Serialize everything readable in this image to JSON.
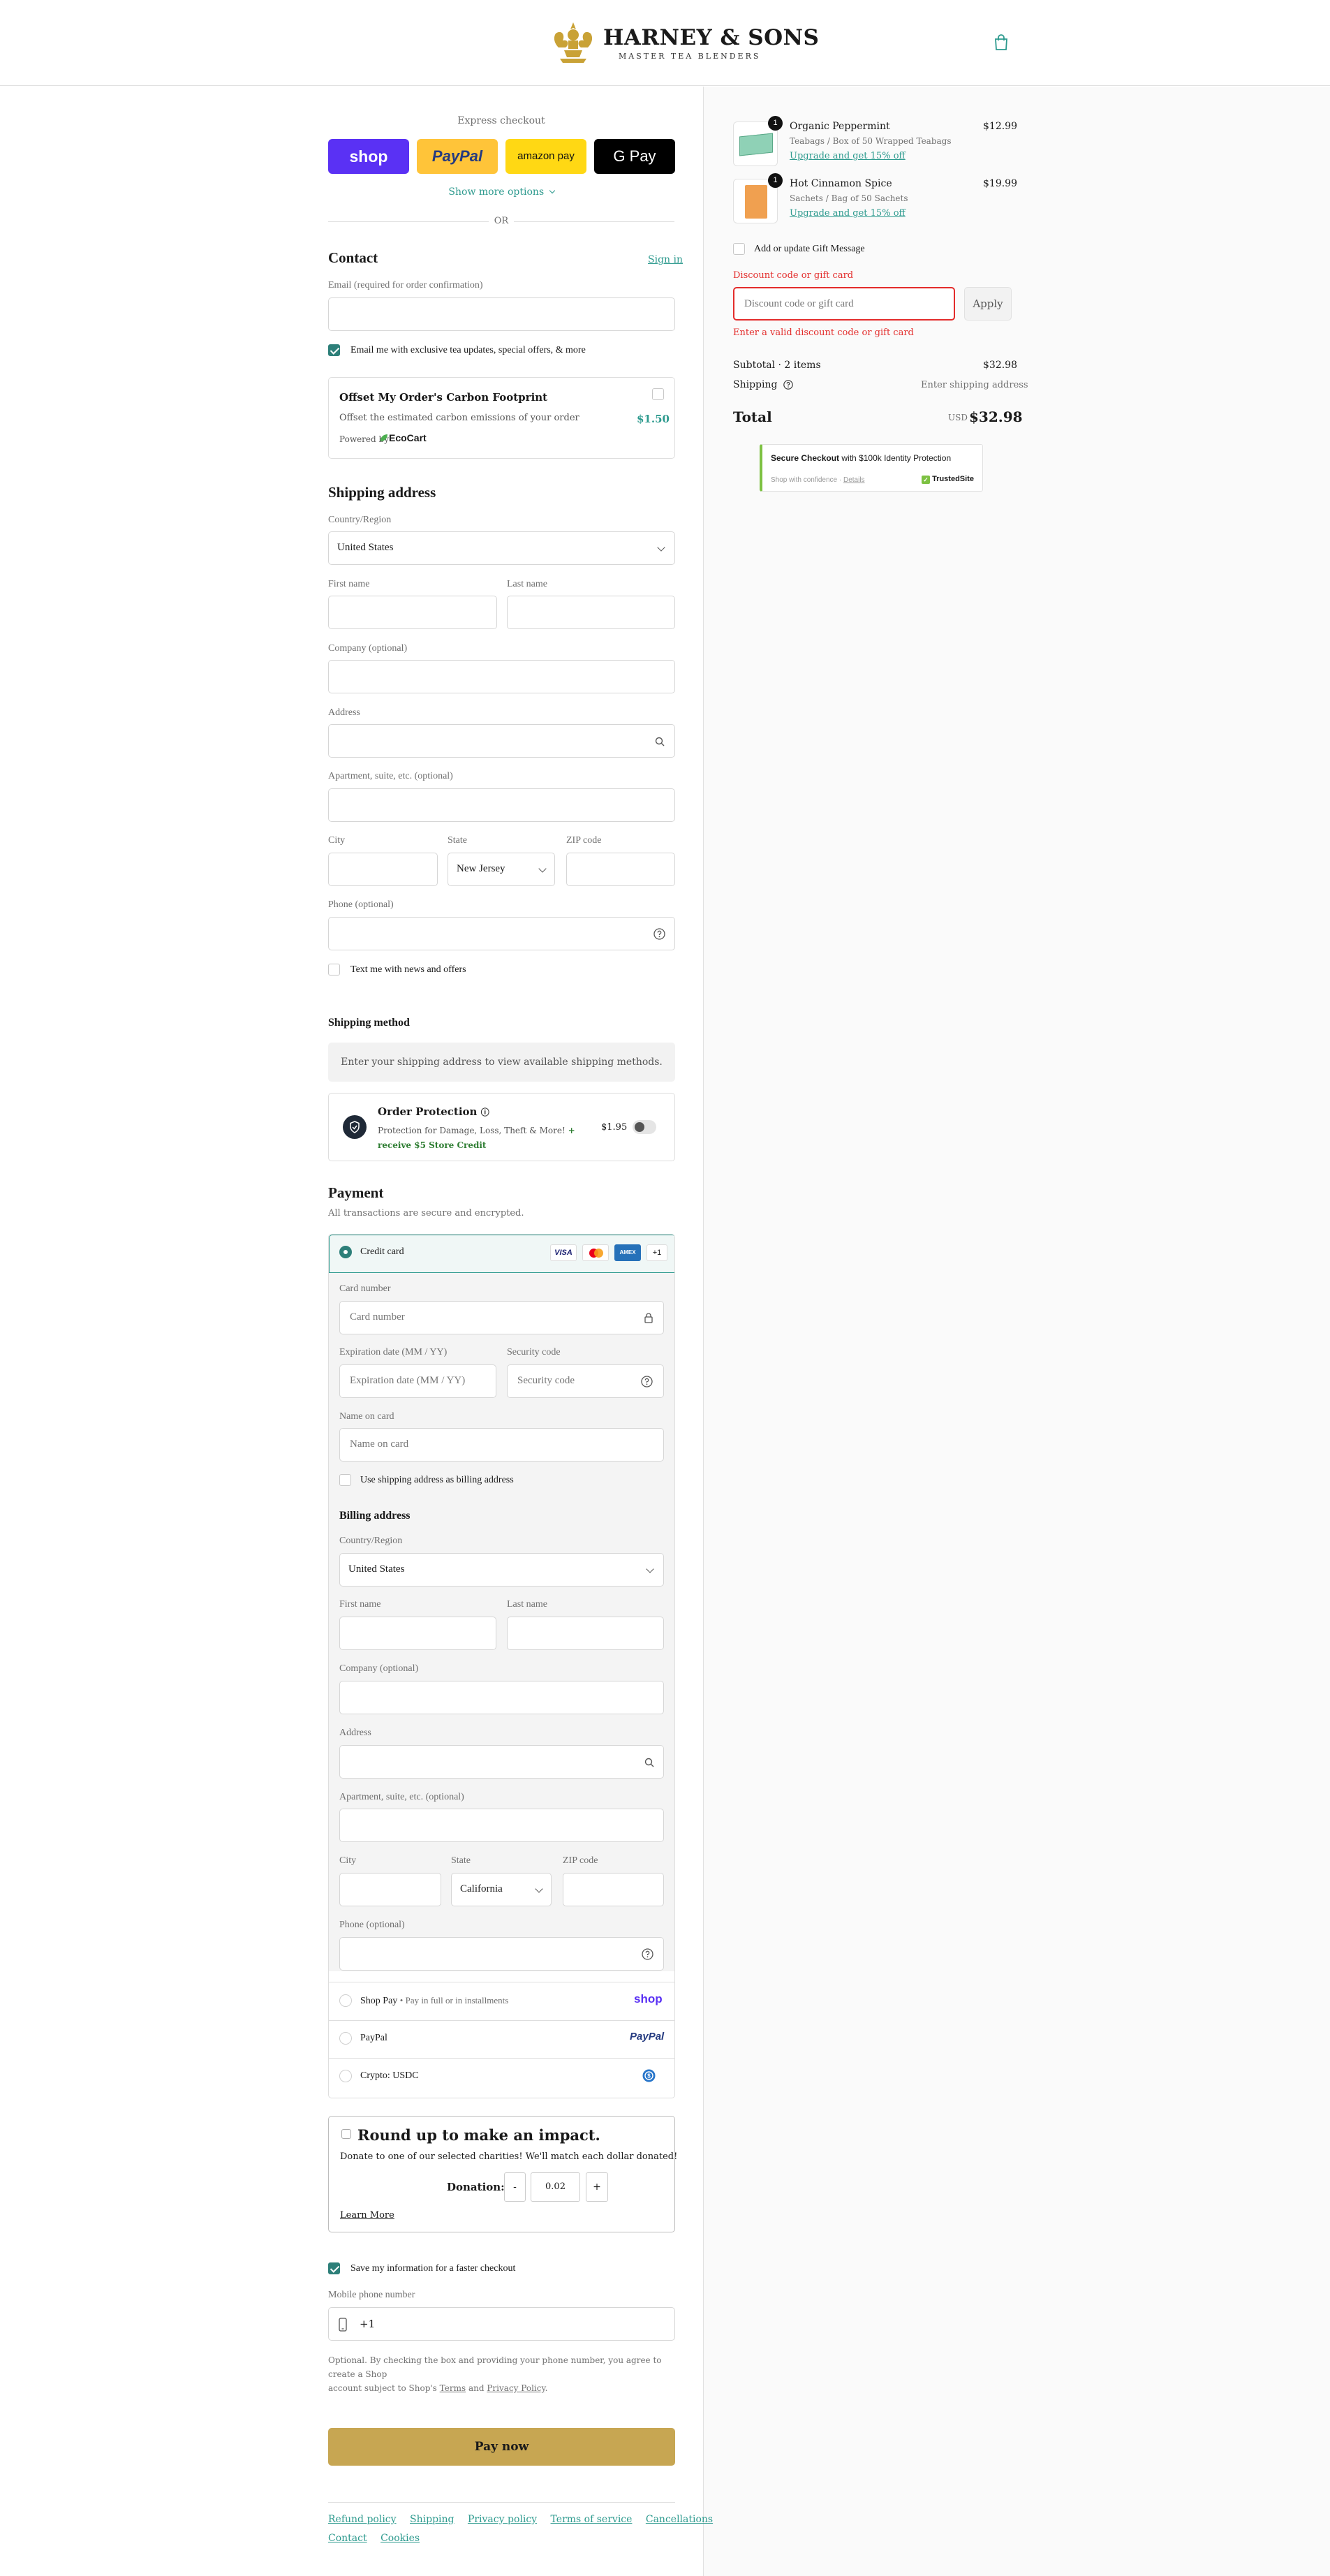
{
  "brand": {
    "name": "HARNEY & SONS",
    "tagline": "MASTER TEA BLENDERS"
  },
  "express": {
    "title": "Express checkout",
    "shop": "shop",
    "paypal": "PayPal",
    "amazon": "amazon pay",
    "gpay": "G Pay",
    "more": "Show more options",
    "or": "OR"
  },
  "contact": {
    "title": "Contact",
    "signin": "Sign in",
    "email_label": "Email (required for order confirmation)",
    "email_value": "",
    "marketing": "Email me with exclusive tea updates, special offers, & more"
  },
  "carbon": {
    "title": "Offset My Order's Carbon Footprint",
    "desc": "Offset the estimated carbon emissions of your order",
    "price": "$1.50",
    "powered": "Powered by",
    "ecocart": "EcoCart"
  },
  "shipping": {
    "title": "Shipping address",
    "country_label": "Country/Region",
    "country": "United States",
    "first": "First name",
    "last": "Last name",
    "company": "Company (optional)",
    "address": "Address",
    "apt": "Apartment, suite, etc. (optional)",
    "city": "City",
    "state_label": "State",
    "state": "New Jersey",
    "zip": "ZIP code",
    "phone": "Phone (optional)",
    "sms": "Text me with news and offers"
  },
  "shipmethod": {
    "title": "Shipping method",
    "notice": "Enter your shipping address to view available shipping methods."
  },
  "protection": {
    "title": "Order Protection",
    "desc": "Protection for Damage, Loss, Theft & More!",
    "credit": "+ receive $5 Store Credit",
    "price": "$1.95"
  },
  "payment": {
    "title": "Payment",
    "subtitle": "All transactions are secure and encrypted.",
    "cc": "Credit card",
    "more_cards": "+1",
    "card_number_label": "Card number",
    "card_number": "Card number",
    "exp_label": "Expiration date (MM / YY)",
    "exp": "Expiration date (MM / YY)",
    "sec_label": "Security code",
    "sec": "Security code",
    "name_label": "Name on card",
    "name": "Name on card",
    "use_shipping": "Use shipping address as billing address",
    "billing_title": "Billing address",
    "b_country_label": "Country/Region",
    "b_country": "United States",
    "b_first": "First name",
    "b_last": "Last name",
    "b_company": "Company (optional)",
    "b_address": "Address",
    "b_apt": "Apartment, suite, etc. (optional)",
    "b_city": "City",
    "b_state_label": "State",
    "b_state": "California",
    "b_zip": "ZIP code",
    "b_phone": "Phone (optional)",
    "shoppay": "Shop Pay",
    "shoppay_sub": "• Pay in full or in installments",
    "shoppay_logo": "shop",
    "paypal": "PayPal",
    "paypal_logo": "PayPal",
    "crypto": "Crypto: USDC"
  },
  "roundup": {
    "title": "Round up to make an impact.",
    "desc": "Donate to one of our selected charities! We'll match each dollar donated!",
    "donation_label": "Donation:",
    "minus": "-",
    "amount": "0.02",
    "plus": "+",
    "learn": "Learn More"
  },
  "save": {
    "label": "Save my information for a faster checkout",
    "mobile_label": "Mobile phone number",
    "prefix": "+1",
    "legal1": "Optional. By checking the box and providing your phone number, you agree to create a Shop",
    "legal2": "account subject to Shop's",
    "terms": "Terms",
    "and": "and",
    "privacy": "Privacy Policy",
    "period": "."
  },
  "paynow": "Pay now",
  "footer": {
    "links": [
      "Refund policy",
      "Shipping",
      "Privacy policy",
      "Terms of service",
      "Cancellations"
    ],
    "links2": [
      "Contact",
      "Cookies"
    ]
  },
  "summary": {
    "items": [
      {
        "qty": "1",
        "name": "Organic Peppermint",
        "variant": "Teabags / Box of 50 Wrapped Teabags",
        "upgrade": "Upgrade and get 15% off",
        "price": "$12.99",
        "color": "#8fd1b6"
      },
      {
        "qty": "1",
        "name": "Hot Cinnamon Spice",
        "variant": "Sachets / Bag of 50 Sachets",
        "upgrade": "Upgrade and get 15% off",
        "price": "$19.99",
        "color": "#f0a050"
      }
    ],
    "gift": "Add or update Gift Message",
    "discount_label": "Discount code or gift card",
    "discount_ph": "Discount code or gift card",
    "apply": "Apply",
    "error": "Enter a valid discount code or gift card",
    "subtotal_label": "Subtotal · 2 items",
    "subtotal": "$32.98",
    "shipping_label": "Shipping",
    "shipping_val": "Enter shipping address",
    "total_label": "Total",
    "currency": "USD",
    "total": "$32.98",
    "trust_title": "Secure Checkout",
    "trust_rest": "with $100k Identity Protection",
    "trust_sub": "Shop with confidence",
    "trust_details": "Details",
    "trust_logo": "TrustedSite"
  }
}
